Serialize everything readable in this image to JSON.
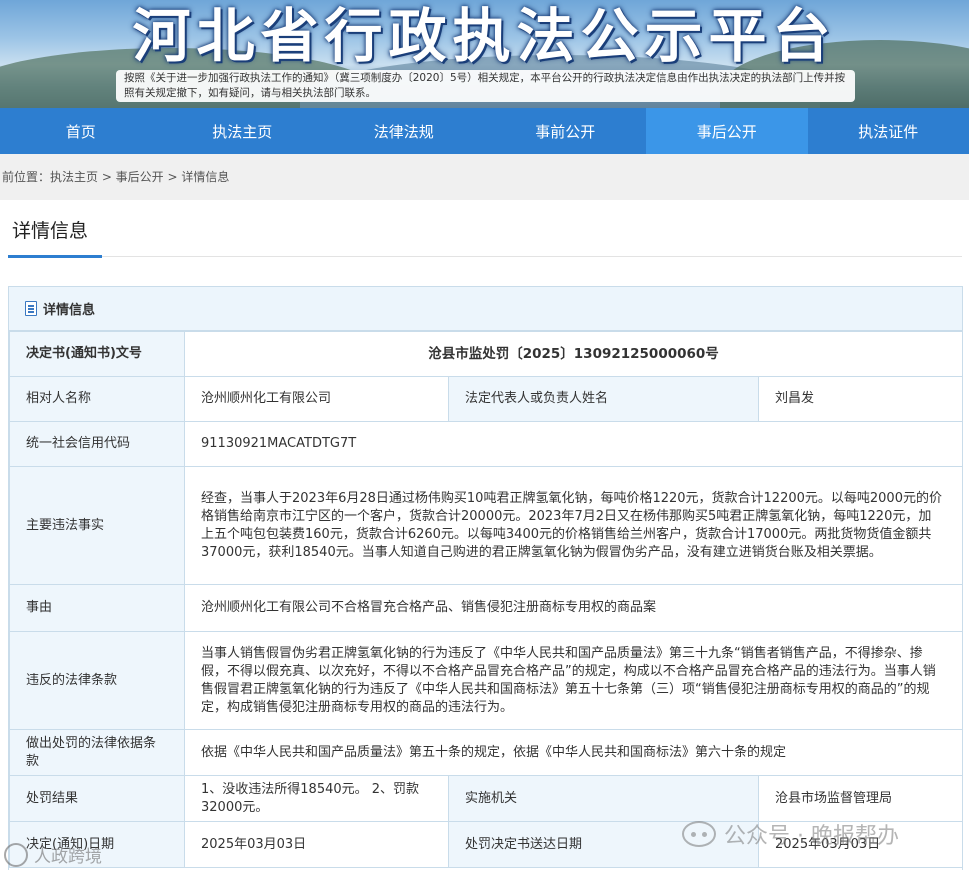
{
  "banner": {
    "title": "河北省行政执法公示平台",
    "notice": "按照《关于进一步加强行政执法工作的通知》（冀三项制度办〔2020〕5号）相关规定，本平台公开的行政执法决定信息由作出执法决定的执法部门上传并按照有关规定撤下，如有疑问，请与相关执法部门联系。"
  },
  "nav": {
    "items": [
      "首页",
      "执法主页",
      "法律法规",
      "事前公开",
      "事后公开",
      "执法证件"
    ],
    "active_index": 4
  },
  "breadcrumb": "前位置：执法主页 > 事后公开 > 详情信息",
  "section_title": "详情信息",
  "panel_title": "详情信息",
  "rows": {
    "decision_no_label": "决定书(通知书)文号",
    "decision_no": "沧县市监处罚〔2025〕13092125000060号",
    "party_label": "相对人名称",
    "party": "沧州顺州化工有限公司",
    "legal_rep_label": "法定代表人或负责人姓名",
    "legal_rep": "刘昌发",
    "credit_code_label": "统一社会信用代码",
    "credit_code": "91130921MACATDTG7T",
    "facts_label": "主要违法事实",
    "facts": "经查，当事人于2023年6月28日通过杨伟购买10吨君正牌氢氧化钠，每吨价格1220元，货款合计12200元。以每吨2000元的价格销售给南京市江宁区的一个客户，货款合计20000元。2023年7月2日又在杨伟那购买5吨君正牌氢氧化钠，每吨1220元，加上五个吨包包装费160元，货款合计6260元。以每吨3400元的价格销售给兰州客户，货款合计17000元。两批货物货值金额共37000元，获利18540元。当事人知道自己购进的君正牌氢氧化钠为假冒伪劣产品，没有建立进销货台账及相关票据。",
    "cause_label": "事由",
    "cause": "沧州顺州化工有限公司不合格冒充合格产品、销售侵犯注册商标专用权的商品案",
    "law_label": "违反的法律条款",
    "law": "当事人销售假冒伪劣君正牌氢氧化钠的行为违反了《中华人民共和国产品质量法》第三十九条“销售者销售产品，不得掺杂、掺假，不得以假充真、以次充好，不得以不合格产品冒充合格产品”的规定，构成以不合格产品冒充合格产品的违法行为。当事人销售假冒君正牌氢氧化钠的行为违反了《中华人民共和国商标法》第五十七条第（三）项“销售侵犯注册商标专用权的商品的”的规定，构成销售侵犯注册商标专用权的商品的违法行为。",
    "basis_label": "做出处罚的法律依据条款",
    "basis": "依据《中华人民共和国产品质量法》第五十条的规定，依据《中华人民共和国商标法》第六十条的规定",
    "result_label": "处罚结果",
    "result": "1、没收违法所得18540元。 2、罚款32000元。",
    "agency_label": "实施机关",
    "agency": "沧县市场监督管理局",
    "decision_date_label": "决定(通知)日期",
    "decision_date": "2025年03月03日",
    "delivery_date_label": "处罚决定书送达日期",
    "delivery_date": "2025年03月03日"
  },
  "watermarks": {
    "right": "公众号 · 晚报帮办",
    "left": "人政跨境"
  }
}
